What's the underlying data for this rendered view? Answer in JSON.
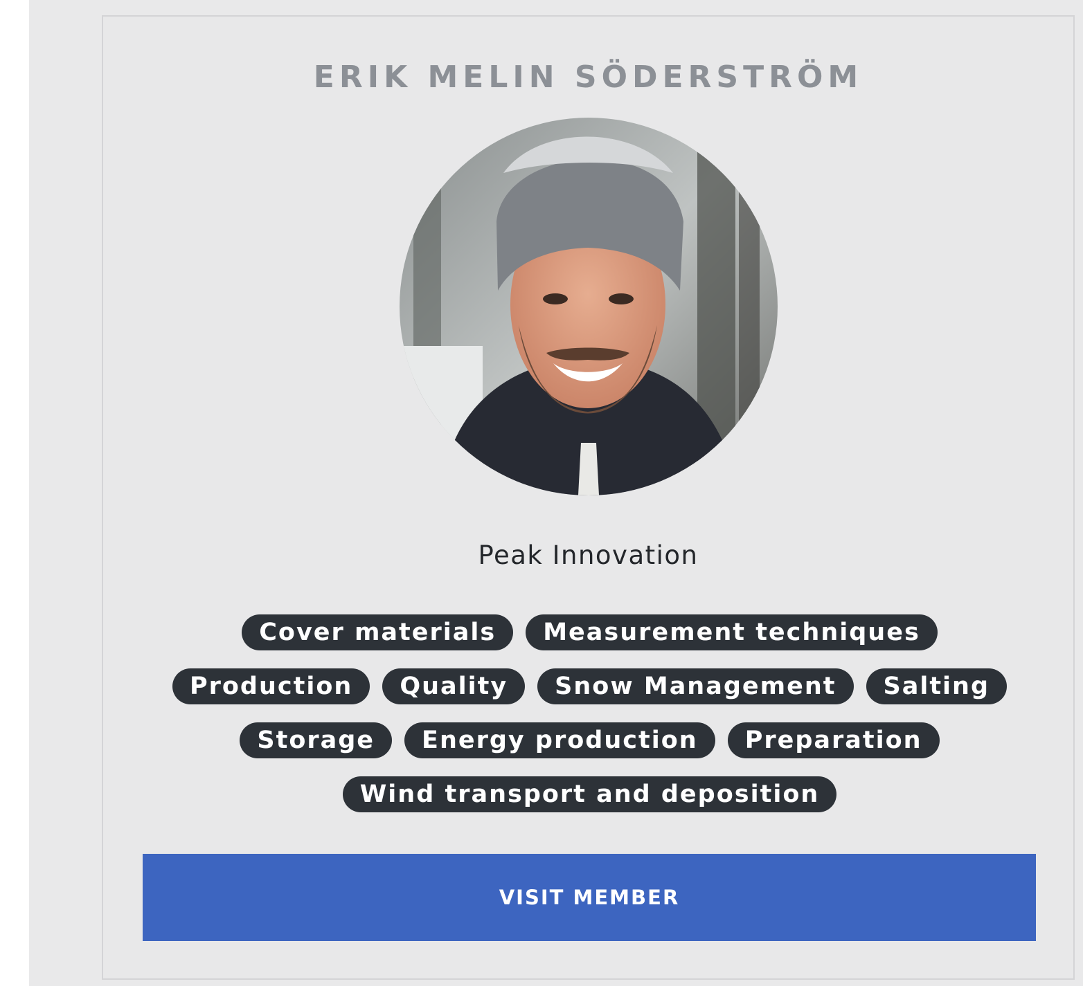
{
  "member": {
    "name": "ERIK MELIN SÖDERSTRÖM",
    "company": "Peak Innovation",
    "photo_icon": "person-photo-icon",
    "tags": [
      "Cover materials",
      "Measurement techniques",
      "Production",
      "Quality",
      "Snow Management",
      "Salting",
      "Storage",
      "Energy production",
      "Preparation",
      "Wind transport and deposition"
    ]
  },
  "actions": {
    "visit_label": "VISIT MEMBER"
  },
  "colors": {
    "accent": "#3d65c0",
    "tag_background": "#2d3238",
    "card_background": "#e8e8e9",
    "name_text": "#8c9096"
  }
}
